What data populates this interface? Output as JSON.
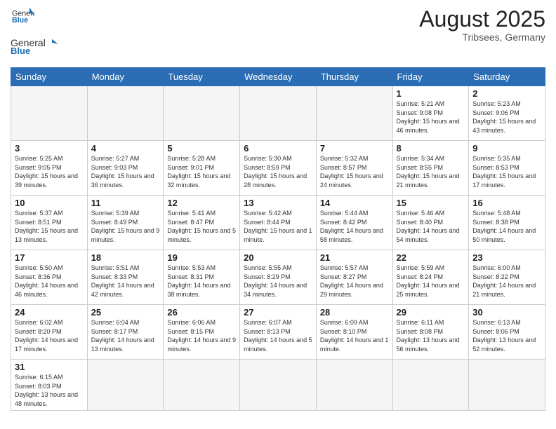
{
  "logo": {
    "text_general": "General",
    "text_blue": "Blue"
  },
  "header": {
    "month": "August 2025",
    "location": "Tribsees, Germany"
  },
  "weekdays": [
    "Sunday",
    "Monday",
    "Tuesday",
    "Wednesday",
    "Thursday",
    "Friday",
    "Saturday"
  ],
  "weeks": [
    [
      {
        "day": "",
        "info": "",
        "empty": true
      },
      {
        "day": "",
        "info": "",
        "empty": true
      },
      {
        "day": "",
        "info": "",
        "empty": true
      },
      {
        "day": "",
        "info": "",
        "empty": true
      },
      {
        "day": "",
        "info": "",
        "empty": true
      },
      {
        "day": "1",
        "info": "Sunrise: 5:21 AM\nSunset: 9:08 PM\nDaylight: 15 hours and 46 minutes."
      },
      {
        "day": "2",
        "info": "Sunrise: 5:23 AM\nSunset: 9:06 PM\nDaylight: 15 hours and 43 minutes."
      }
    ],
    [
      {
        "day": "3",
        "info": "Sunrise: 5:25 AM\nSunset: 9:05 PM\nDaylight: 15 hours and 39 minutes."
      },
      {
        "day": "4",
        "info": "Sunrise: 5:27 AM\nSunset: 9:03 PM\nDaylight: 15 hours and 36 minutes."
      },
      {
        "day": "5",
        "info": "Sunrise: 5:28 AM\nSunset: 9:01 PM\nDaylight: 15 hours and 32 minutes."
      },
      {
        "day": "6",
        "info": "Sunrise: 5:30 AM\nSunset: 8:59 PM\nDaylight: 15 hours and 28 minutes."
      },
      {
        "day": "7",
        "info": "Sunrise: 5:32 AM\nSunset: 8:57 PM\nDaylight: 15 hours and 24 minutes."
      },
      {
        "day": "8",
        "info": "Sunrise: 5:34 AM\nSunset: 8:55 PM\nDaylight: 15 hours and 21 minutes."
      },
      {
        "day": "9",
        "info": "Sunrise: 5:35 AM\nSunset: 8:53 PM\nDaylight: 15 hours and 17 minutes."
      }
    ],
    [
      {
        "day": "10",
        "info": "Sunrise: 5:37 AM\nSunset: 8:51 PM\nDaylight: 15 hours and 13 minutes."
      },
      {
        "day": "11",
        "info": "Sunrise: 5:39 AM\nSunset: 8:49 PM\nDaylight: 15 hours and 9 minutes."
      },
      {
        "day": "12",
        "info": "Sunrise: 5:41 AM\nSunset: 8:47 PM\nDaylight: 15 hours and 5 minutes."
      },
      {
        "day": "13",
        "info": "Sunrise: 5:42 AM\nSunset: 8:44 PM\nDaylight: 15 hours and 1 minute."
      },
      {
        "day": "14",
        "info": "Sunrise: 5:44 AM\nSunset: 8:42 PM\nDaylight: 14 hours and 58 minutes."
      },
      {
        "day": "15",
        "info": "Sunrise: 5:46 AM\nSunset: 8:40 PM\nDaylight: 14 hours and 54 minutes."
      },
      {
        "day": "16",
        "info": "Sunrise: 5:48 AM\nSunset: 8:38 PM\nDaylight: 14 hours and 50 minutes."
      }
    ],
    [
      {
        "day": "17",
        "info": "Sunrise: 5:50 AM\nSunset: 8:36 PM\nDaylight: 14 hours and 46 minutes."
      },
      {
        "day": "18",
        "info": "Sunrise: 5:51 AM\nSunset: 8:33 PM\nDaylight: 14 hours and 42 minutes."
      },
      {
        "day": "19",
        "info": "Sunrise: 5:53 AM\nSunset: 8:31 PM\nDaylight: 14 hours and 38 minutes."
      },
      {
        "day": "20",
        "info": "Sunrise: 5:55 AM\nSunset: 8:29 PM\nDaylight: 14 hours and 34 minutes."
      },
      {
        "day": "21",
        "info": "Sunrise: 5:57 AM\nSunset: 8:27 PM\nDaylight: 14 hours and 29 minutes."
      },
      {
        "day": "22",
        "info": "Sunrise: 5:59 AM\nSunset: 8:24 PM\nDaylight: 14 hours and 25 minutes."
      },
      {
        "day": "23",
        "info": "Sunrise: 6:00 AM\nSunset: 8:22 PM\nDaylight: 14 hours and 21 minutes."
      }
    ],
    [
      {
        "day": "24",
        "info": "Sunrise: 6:02 AM\nSunset: 8:20 PM\nDaylight: 14 hours and 17 minutes."
      },
      {
        "day": "25",
        "info": "Sunrise: 6:04 AM\nSunset: 8:17 PM\nDaylight: 14 hours and 13 minutes."
      },
      {
        "day": "26",
        "info": "Sunrise: 6:06 AM\nSunset: 8:15 PM\nDaylight: 14 hours and 9 minutes."
      },
      {
        "day": "27",
        "info": "Sunrise: 6:07 AM\nSunset: 8:13 PM\nDaylight: 14 hours and 5 minutes."
      },
      {
        "day": "28",
        "info": "Sunrise: 6:09 AM\nSunset: 8:10 PM\nDaylight: 14 hours and 1 minute."
      },
      {
        "day": "29",
        "info": "Sunrise: 6:11 AM\nSunset: 8:08 PM\nDaylight: 13 hours and 56 minutes."
      },
      {
        "day": "30",
        "info": "Sunrise: 6:13 AM\nSunset: 8:06 PM\nDaylight: 13 hours and 52 minutes."
      }
    ],
    [
      {
        "day": "31",
        "info": "Sunrise: 6:15 AM\nSunset: 8:03 PM\nDaylight: 13 hours and 48 minutes."
      },
      {
        "day": "",
        "info": "",
        "empty": true
      },
      {
        "day": "",
        "info": "",
        "empty": true
      },
      {
        "day": "",
        "info": "",
        "empty": true
      },
      {
        "day": "",
        "info": "",
        "empty": true
      },
      {
        "day": "",
        "info": "",
        "empty": true
      },
      {
        "day": "",
        "info": "",
        "empty": true
      }
    ]
  ]
}
